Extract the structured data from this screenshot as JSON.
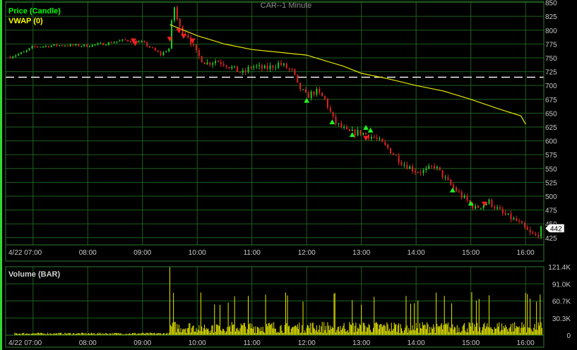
{
  "colors": {
    "background": "#000000",
    "grid": "#1f5f1f",
    "axis_text": "#c8c8c8",
    "up": "#22cc22",
    "down": "#dd2222",
    "vwap": "#e6e600",
    "volume": "#e6e600",
    "frame": "#2e7d2e",
    "legend_price": "#00ff00",
    "legend_vwap": "#ffff00",
    "legend_volume": "#d0d0d0",
    "arrow_up": "#22ee22",
    "arrow_down": "#ee2222",
    "dashed_line": "#ffffff",
    "last_price_bg": "#ffffff"
  },
  "chart_title": "CAR--1 Minute",
  "legend": {
    "price": "Price (Candle)",
    "vwap": "VWAP (0)",
    "volume": "Volume (BAR)"
  },
  "last_price_label": "442",
  "chart_data": [
    {
      "type": "candlestick",
      "title": "CAR--1 Minute",
      "ylim": [
        412,
        852
      ],
      "xlim": [
        "06:30",
        "16:20"
      ],
      "x_ticks": [
        "4/22",
        "07:00",
        "08:00",
        "09:00",
        "10:00",
        "11:00",
        "12:00",
        "13:00",
        "14:00",
        "15:00",
        "16:00"
      ],
      "y_ticks": [
        850,
        825,
        800,
        775,
        750,
        725,
        700,
        675,
        650,
        625,
        600,
        575,
        550,
        525,
        500,
        475,
        450,
        425
      ],
      "reference_line": 715,
      "price_path": [
        [
          "06:35",
          752
        ],
        [
          "06:50",
          760
        ],
        [
          "07:00",
          770
        ],
        [
          "07:30",
          773
        ],
        [
          "08:00",
          772
        ],
        [
          "08:20",
          776
        ],
        [
          "08:40",
          782
        ],
        [
          "09:00",
          778
        ],
        [
          "09:20",
          756
        ],
        [
          "09:30",
          768
        ],
        [
          "09:32",
          812
        ],
        [
          "09:35",
          842
        ],
        [
          "09:40",
          805
        ],
        [
          "09:50",
          790
        ],
        [
          "10:00",
          755
        ],
        [
          "10:10",
          740
        ],
        [
          "10:20",
          745
        ],
        [
          "10:30",
          740
        ],
        [
          "10:40",
          730
        ],
        [
          "10:50",
          722
        ],
        [
          "11:00",
          735
        ],
        [
          "11:15",
          730
        ],
        [
          "11:30",
          740
        ],
        [
          "11:45",
          725
        ],
        [
          "11:50",
          700
        ],
        [
          "12:00",
          680
        ],
        [
          "12:10",
          690
        ],
        [
          "12:20",
          675
        ],
        [
          "12:30",
          635
        ],
        [
          "12:45",
          615
        ],
        [
          "13:00",
          615
        ],
        [
          "13:15",
          605
        ],
        [
          "13:30",
          585
        ],
        [
          "13:45",
          560
        ],
        [
          "14:00",
          545
        ],
        [
          "14:10",
          545
        ],
        [
          "14:20",
          555
        ],
        [
          "14:35",
          525
        ],
        [
          "14:50",
          500
        ],
        [
          "15:05",
          478
        ],
        [
          "15:20",
          490
        ],
        [
          "15:35",
          468
        ],
        [
          "15:50",
          455
        ],
        [
          "16:05",
          432
        ],
        [
          "16:12",
          428
        ],
        [
          "16:18",
          442
        ]
      ],
      "vwap_path": [
        [
          "09:30",
          810
        ],
        [
          "10:00",
          790
        ],
        [
          "10:30",
          775
        ],
        [
          "11:00",
          765
        ],
        [
          "11:30",
          760
        ],
        [
          "12:00",
          755
        ],
        [
          "12:20",
          745
        ],
        [
          "12:40",
          735
        ],
        [
          "13:00",
          722
        ],
        [
          "13:30",
          712
        ],
        [
          "14:00",
          700
        ],
        [
          "14:30",
          690
        ],
        [
          "15:00",
          675
        ],
        [
          "15:30",
          658
        ],
        [
          "15:55",
          645
        ],
        [
          "16:00",
          630
        ]
      ],
      "up_arrows": [
        [
          "12:00",
          674
        ],
        [
          "12:28",
          635
        ],
        [
          "12:50",
          612
        ],
        [
          "13:05",
          625
        ],
        [
          "13:10",
          620
        ],
        [
          "14:40",
          512
        ],
        [
          "15:00",
          488
        ]
      ],
      "down_arrows": [
        [
          "08:50",
          780
        ],
        [
          "08:52",
          775
        ],
        [
          "09:30",
          783
        ],
        [
          "09:40",
          798
        ],
        [
          "09:45",
          788
        ],
        [
          "09:55",
          780
        ],
        [
          "13:05",
          604
        ],
        [
          "15:15",
          485
        ]
      ],
      "up_color": "#22cc22",
      "down_color": "#dd2222"
    },
    {
      "type": "bar",
      "title": "Volume (BAR)",
      "ylim": [
        0,
        121400
      ],
      "y_ticks": [
        "121.4K",
        "91.0K",
        "60.7K",
        "30.3K",
        "0"
      ],
      "x_ticks": [
        "4/22",
        "07:00",
        "08:00",
        "09:00",
        "10:00",
        "11:00",
        "12:00",
        "13:00",
        "14:00",
        "15:00",
        "16:00"
      ],
      "spikes": [
        [
          "09:30",
          121400
        ],
        [
          "09:34",
          75000
        ],
        [
          "11:15",
          72000
        ],
        [
          "12:50",
          62000
        ],
        [
          "16:00",
          75000
        ],
        [
          "16:02",
          73000
        ]
      ],
      "premarket_level": 3000,
      "session_typical_level": 18000
    }
  ]
}
